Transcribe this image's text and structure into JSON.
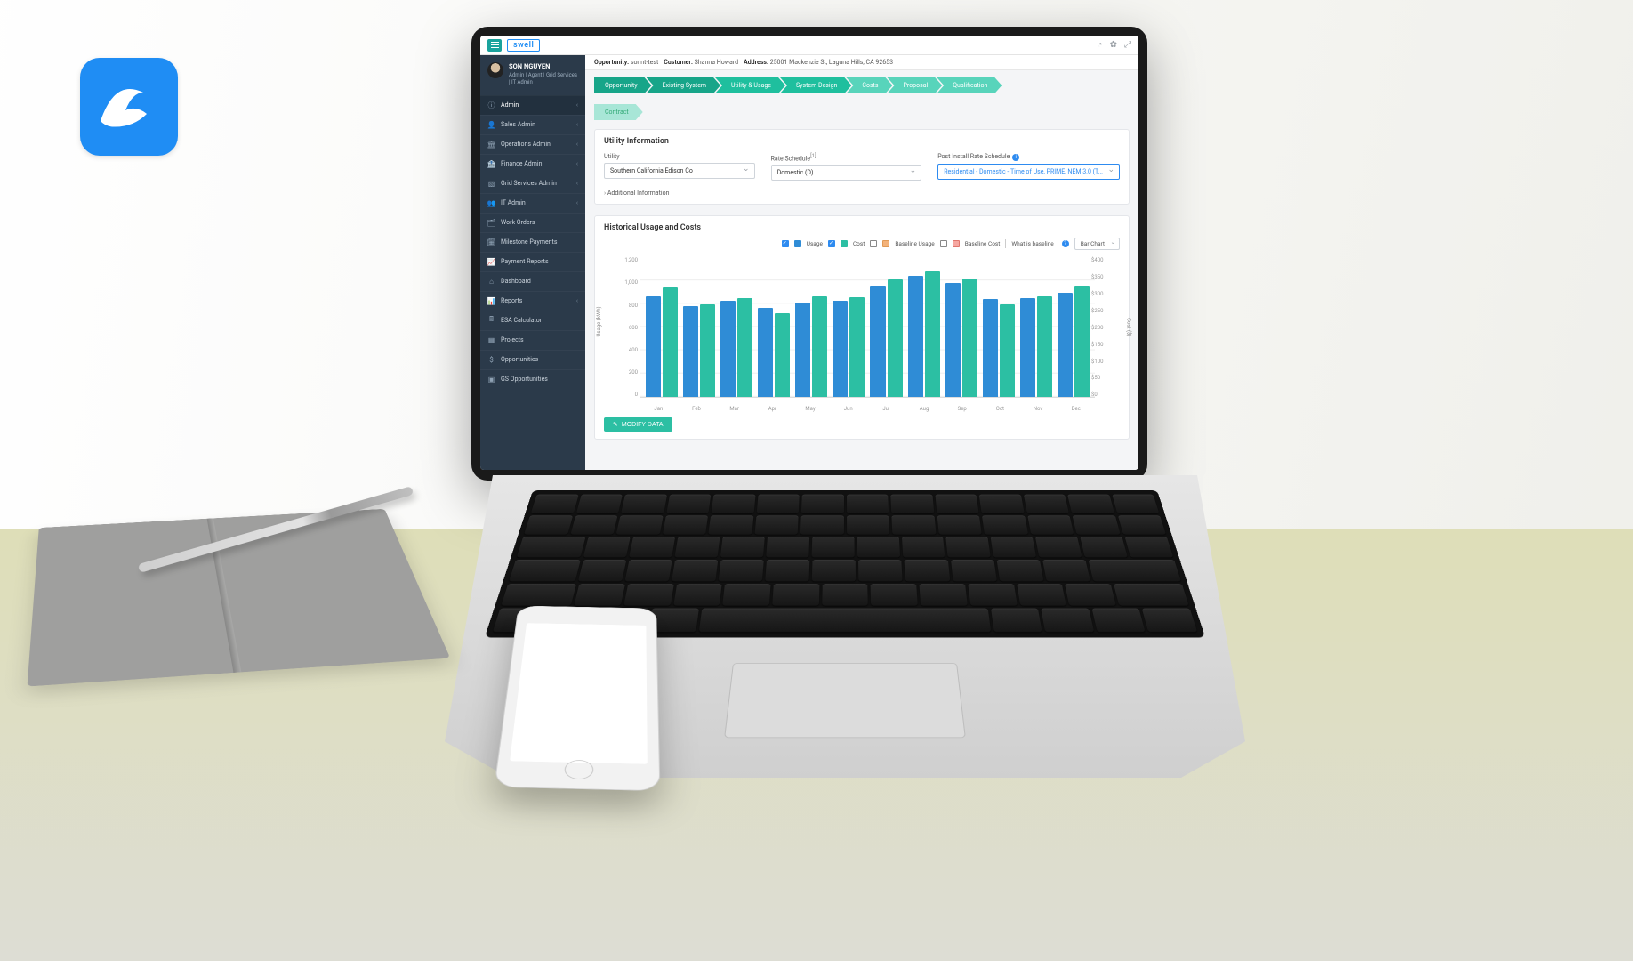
{
  "brand": "swell",
  "user": {
    "name": "SON NGUYEN",
    "roles": "Admin | Agent | Grid Services | IT Admin"
  },
  "sidebar": {
    "items": [
      {
        "label": "Admin",
        "icon": "ⓘ",
        "expandable": true,
        "active": true
      },
      {
        "label": "Sales Admin",
        "icon": "👤",
        "expandable": true
      },
      {
        "label": "Operations Admin",
        "icon": "🏛",
        "expandable": true
      },
      {
        "label": "Finance Admin",
        "icon": "🏦",
        "expandable": true
      },
      {
        "label": "Grid Services Admin",
        "icon": "▧",
        "expandable": true
      },
      {
        "label": "IT Admin",
        "icon": "👥",
        "expandable": true
      },
      {
        "label": "Work Orders",
        "icon": "🗂",
        "expandable": false
      },
      {
        "label": "Milestone Payments",
        "icon": "🗓",
        "expandable": false
      },
      {
        "label": "Payment Reports",
        "icon": "📈",
        "expandable": false
      },
      {
        "label": "Dashboard",
        "icon": "⌂",
        "expandable": false
      },
      {
        "label": "Reports",
        "icon": "📊",
        "expandable": true
      },
      {
        "label": "ESA Calculator",
        "icon": "🖩",
        "expandable": false
      },
      {
        "label": "Projects",
        "icon": "▦",
        "expandable": false
      },
      {
        "label": "Opportunities",
        "icon": "$",
        "expandable": false
      },
      {
        "label": "GS Opportunities",
        "icon": "▣",
        "expandable": false
      }
    ]
  },
  "crumb": {
    "opportunity_label": "Opportunity:",
    "opportunity_value": "sonnt-test",
    "customer_label": "Customer:",
    "customer_value": "Shanna Howard",
    "address_label": "Address:",
    "address_value": "25001 Mackenzie St, Laguna Hills, CA 92653"
  },
  "steps": [
    {
      "label": "Opportunity",
      "tone": "g-dark"
    },
    {
      "label": "Existing System",
      "tone": "g-dark"
    },
    {
      "label": "Utility & Usage",
      "tone": "g-mid"
    },
    {
      "label": "System Design",
      "tone": "g-mid"
    },
    {
      "label": "Costs",
      "tone": "g-light"
    },
    {
      "label": "Proposal",
      "tone": "g-light"
    },
    {
      "label": "Qualification",
      "tone": "g-light"
    },
    {
      "label": "Contract",
      "tone": "g-xlight"
    }
  ],
  "utility_panel": {
    "title": "Utility Information",
    "utility_label": "Utility",
    "utility_value": "Southern California Edison Co",
    "rate_label": "Rate Schedule",
    "rate_sup": "[1]",
    "rate_value": "Domestic (D)",
    "post_label": "Post Install Rate Schedule",
    "post_value": "Residential - Domestic - Time of Use, PRIME, NEM 3.0 (T...",
    "additional": "Additional Information"
  },
  "chart_panel": {
    "title": "Historical Usage and Costs",
    "legend": {
      "usage": "Usage",
      "cost": "Cost",
      "baseline_usage": "Baseline Usage",
      "baseline_cost": "Baseline Cost",
      "what_is": "What is baseline"
    },
    "chart_type": "Bar Chart",
    "y_left_label": "Usage (kWh)",
    "y_right_label": "Cost ($)",
    "modify": "MODIFY DATA"
  },
  "chart_data": {
    "type": "bar",
    "categories": [
      "Jan",
      "Feb",
      "Mar",
      "Apr",
      "May",
      "Jun",
      "Jul",
      "Aug",
      "Sep",
      "Oct",
      "Nov",
      "Dec"
    ],
    "series": [
      {
        "name": "Usage",
        "axis": "left",
        "values": [
          870,
          780,
          830,
          770,
          810,
          830,
          960,
          1040,
          980,
          840,
          850,
          900
        ]
      },
      {
        "name": "Cost",
        "axis": "left_scaled",
        "values": [
          940,
          800,
          850,
          720,
          870,
          860,
          1010,
          1080,
          1020,
          800,
          870,
          960
        ]
      }
    ],
    "ylabel_left": "Usage (kWh)",
    "ylim_left": [
      0,
      1200
    ],
    "yticks_left": [
      0,
      200,
      400,
      600,
      800,
      1000,
      1200
    ],
    "ylabel_right": "Cost ($)",
    "ylim_right": [
      0,
      400
    ],
    "yticks_right": [
      "$0",
      "$50",
      "$100",
      "$150",
      "$200",
      "$250",
      "$300",
      "$350",
      "$400"
    ]
  }
}
